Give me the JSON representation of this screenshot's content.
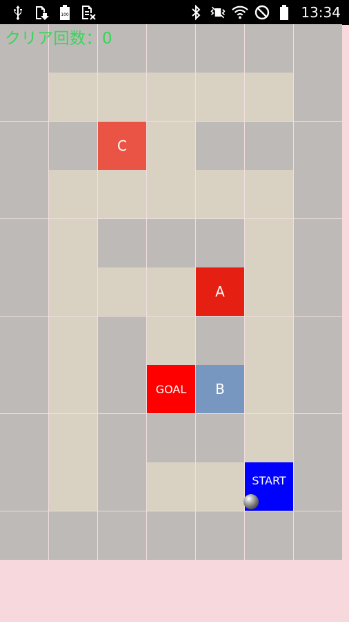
{
  "status_bar": {
    "time": "13:34",
    "battery_badge": "100",
    "left_icons": [
      "usb-icon",
      "download-icon",
      "battery-saver-icon",
      "sim-icon"
    ],
    "right_icons": [
      "bluetooth-icon",
      "vibrate-icon",
      "wifi-icon",
      "do-not-disturb-icon",
      "battery-icon"
    ]
  },
  "game": {
    "counter_label": "クリア回数：0",
    "clear_count": 0,
    "colors": {
      "wall": "#bdbab7",
      "path": "#d9d2c3",
      "grid_line": "#f1dede",
      "background": "#f7d8dd",
      "counter_text": "#3ad45a"
    },
    "legend": {
      "W": "wall",
      "P": "path",
      "C": "block-c",
      "A": "block-a",
      "B": "block-b",
      "G": "goal",
      "S": "start"
    },
    "labeled_cells": {
      "A": {
        "label": "A",
        "color": "#e51f12"
      },
      "B": {
        "label": "B",
        "color": "#7797c1"
      },
      "C": {
        "label": "C",
        "color": "#ea5444"
      },
      "G": {
        "label": "GOAL",
        "color": "#ff0000"
      },
      "S": {
        "label": "START",
        "color": "#0000ff"
      }
    },
    "grid": [
      "WWWWWWW",
      "WPPPPPW",
      "WWCPWWW",
      "WPPPPPW",
      "WPWWWPW",
      "WPPPAPW",
      "WPWPWPW",
      "WPWGBPW",
      "WPWWWPW",
      "WPWPPSW",
      "WWWWWWW"
    ],
    "ball": {
      "row": 9,
      "col": 5
    }
  }
}
